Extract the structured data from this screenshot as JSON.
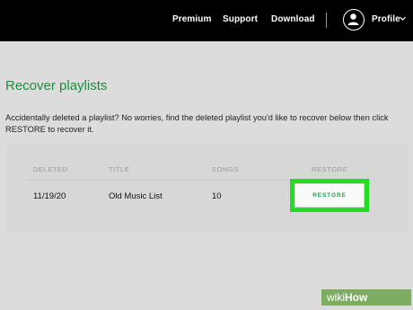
{
  "header": {
    "nav": [
      "Premium",
      "Support",
      "Download"
    ],
    "profile_label": "Profile"
  },
  "main": {
    "title": "Recover playlists",
    "description": "Accidentally deleted a playlist? No worries, find the deleted playlist you'd like to recover below ⁠then click RESTORE to recover it."
  },
  "table": {
    "headers": [
      "DELETED",
      "TITLE",
      "SONGS",
      "RESTORE"
    ],
    "rows": [
      {
        "deleted": "11/19/20",
        "title": "Old Music List",
        "songs": "10",
        "action": "RESTORE"
      }
    ]
  },
  "watermark": {
    "prefix": "wiki",
    "suffix": "How"
  },
  "colors": {
    "accent": "#1a8f3e",
    "highlight": "#22dd22",
    "topbar": "#000000"
  },
  "icons": {
    "profile": "user-icon",
    "dropdown": "chevron-down-icon"
  }
}
